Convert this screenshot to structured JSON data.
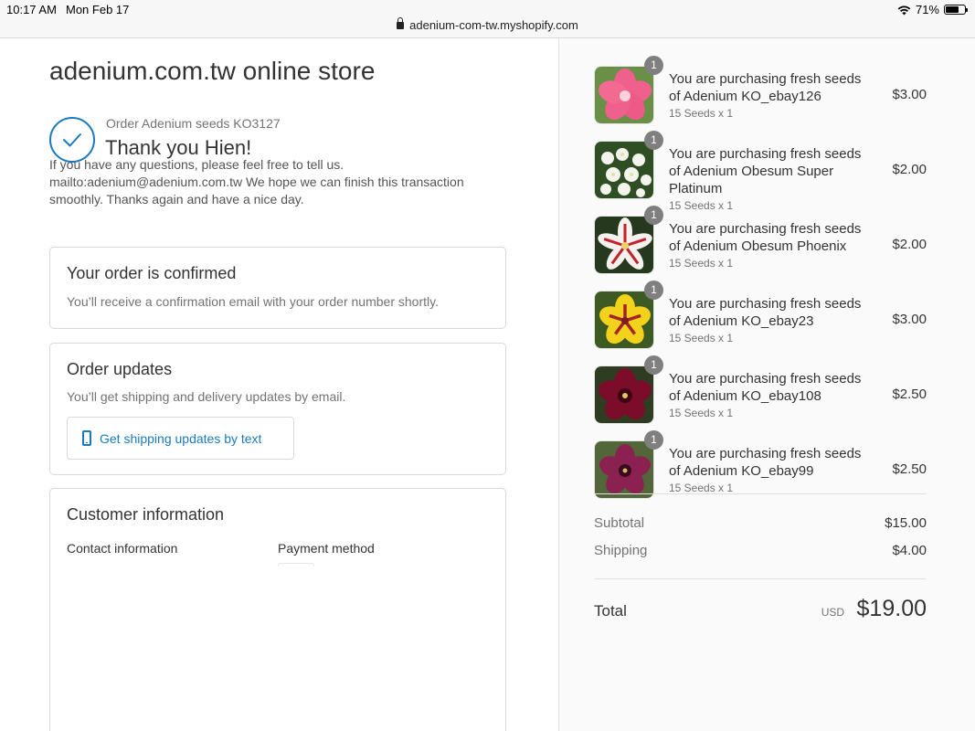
{
  "status_bar": {
    "time": "10:17 AM",
    "date": "Mon Feb 17",
    "url": "adenium-com-tw.myshopify.com",
    "battery": "71%",
    "battery_level": 0.71
  },
  "store": {
    "title": "adenium.com.tw online store"
  },
  "order": {
    "id": "Order Adenium seeds KO3127",
    "thanks": "Thank you Hien!",
    "notes": "If you have any questions, please feel free to tell us. mailto:adenium@adenium.com.tw We hope we can finish this transaction smoothly. Thanks again and have a nice day."
  },
  "confirmed": {
    "title": "Your order is confirmed",
    "text": "You’ll receive a confirmation email with your order number shortly."
  },
  "updates": {
    "title": "Order updates",
    "text": "You’ll get shipping and delivery updates by email.",
    "sms_button": "Get shipping updates by text"
  },
  "customer": {
    "title": "Customer information",
    "contact_label": "Contact information",
    "payment_label": "Payment method"
  },
  "items": [
    {
      "name": "You are purchasing fresh seeds of Adenium KO_ebay126",
      "variant": "15 Seeds x 1",
      "price": "$3.00",
      "quantity": "1"
    },
    {
      "name": "You are purchasing fresh seeds of Adenium Obesum Super Platinum",
      "variant": "15 Seeds x 1",
      "price": "$2.00",
      "quantity": "1"
    },
    {
      "name": "You are purchasing fresh seeds of Adenium Obesum Phoenix",
      "variant": "15 Seeds x 1",
      "price": "$2.00",
      "quantity": "1"
    },
    {
      "name": "You are purchasing fresh seeds of Adenium KO_ebay23",
      "variant": "15 Seeds x 1",
      "price": "$3.00",
      "quantity": "1"
    },
    {
      "name": "You are purchasing fresh seeds of Adenium KO_ebay108",
      "variant": "15 Seeds x 1",
      "price": "$2.50",
      "quantity": "1"
    },
    {
      "name": "You are purchasing fresh seeds of Adenium KO_ebay99",
      "variant": "15 Seeds x 1",
      "price": "$2.50",
      "quantity": "1"
    }
  ],
  "summary": {
    "subtotal_label": "Subtotal",
    "subtotal": "$15.00",
    "shipping_label": "Shipping",
    "shipping": "$4.00",
    "total_label": "Total",
    "currency": "USD",
    "total": "$19.00"
  },
  "colors": {
    "accent": "#197bbd",
    "badge": "#7f7f7f"
  }
}
